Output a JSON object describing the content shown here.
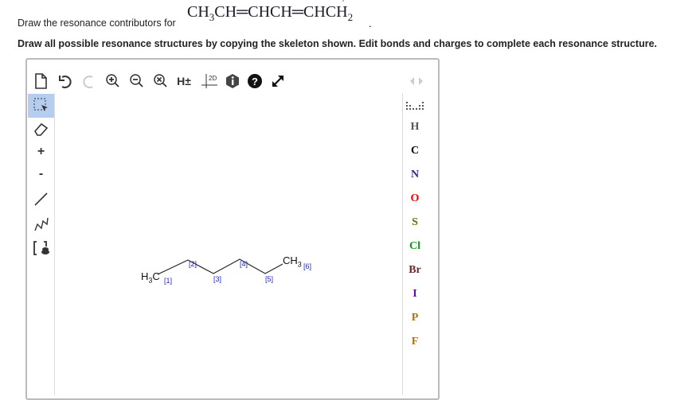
{
  "question": {
    "formula_parts": [
      "CH",
      "3",
      "CH",
      "CHCH",
      "CHCH",
      "2"
    ],
    "formula_charge": "+",
    "prompt": "Draw the resonance contributors for",
    "period": ".",
    "instruction": "Draw all possible resonance structures by copying the skeleton shown. Edit bonds and charges to complete each resonance structure."
  },
  "toolbar": {
    "h_toggle": "H±",
    "clean2d": "2D"
  },
  "left_tools": {
    "plus": "+",
    "minus": "-"
  },
  "elements": [
    {
      "symbol": "H",
      "color": "#555555"
    },
    {
      "symbol": "C",
      "color": "#000000"
    },
    {
      "symbol": "N",
      "color": "#2a2aa0"
    },
    {
      "symbol": "O",
      "color": "#ff0000"
    },
    {
      "symbol": "S",
      "color": "#6b6b10"
    },
    {
      "symbol": "Cl",
      "color": "#10a010"
    },
    {
      "symbol": "Br",
      "color": "#6b2a2a"
    },
    {
      "symbol": "I",
      "color": "#6a0aa0"
    },
    {
      "symbol": "P",
      "color": "#b07010"
    },
    {
      "symbol": "F",
      "color": "#b07010"
    }
  ],
  "molecule": {
    "left_group": [
      "H",
      "3",
      "C"
    ],
    "right_group": [
      "CH",
      "3"
    ],
    "atom_numbers": [
      "[1]",
      "[2]",
      "[3]",
      "[4]",
      "[5]",
      "[6]"
    ]
  }
}
